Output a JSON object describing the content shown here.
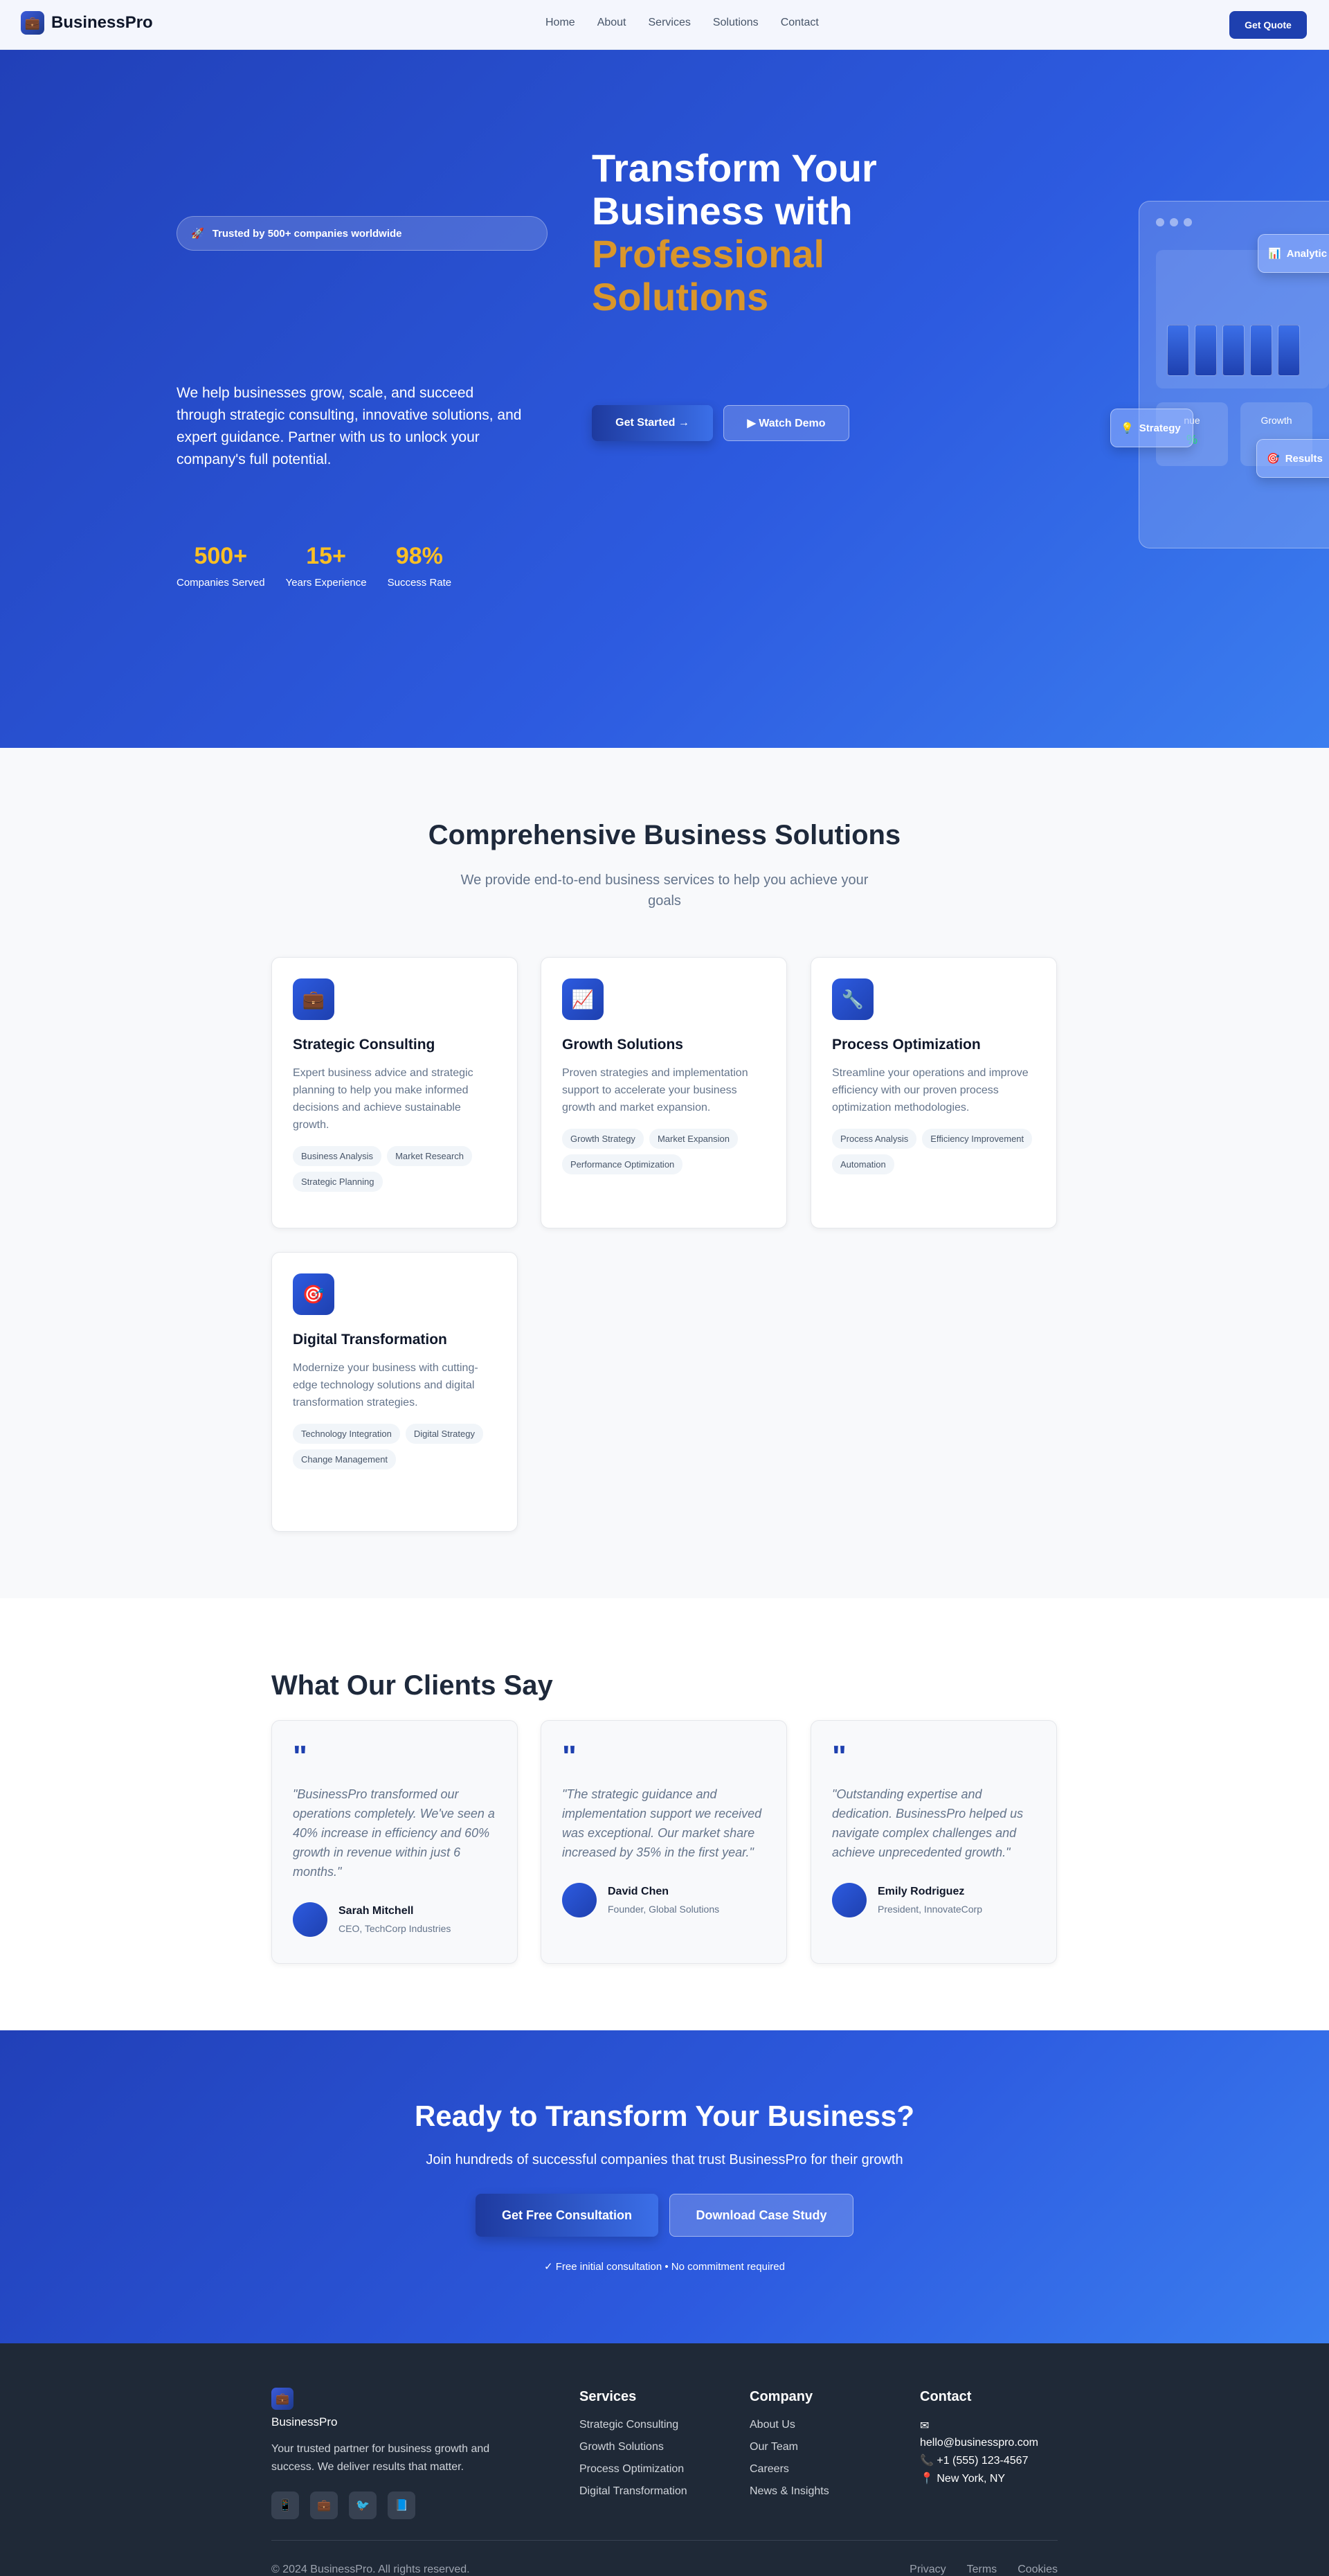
{
  "brand": {
    "name": "BusinessPro",
    "accent": "#1e40af",
    "highlight": "#d9962b"
  },
  "nav": {
    "links": [
      "Home",
      "About",
      "Services",
      "Solutions",
      "Contact"
    ],
    "cta": "Get Quote"
  },
  "hero": {
    "badge": "Trusted by 500+ companies worldwide",
    "title_line1": "Transform Your",
    "title_line2": "Business with",
    "title_highlight1": "Professional",
    "title_highlight2": "Solutions",
    "description": "We help businesses grow, scale, and succeed through strategic consulting, innovative solutions, and expert guidance. Partner with us to unlock your company's full potential.",
    "primary_button": "Get Started →",
    "secondary_button": "▶ Watch Demo",
    "stats": [
      {
        "value": "500+",
        "label": "Companies Served"
      },
      {
        "value": "15+",
        "label": "Years Experience"
      },
      {
        "value": "98%",
        "label": "Success Rate"
      }
    ],
    "dashboard": {
      "mini1_label": "nue",
      "mini1_value": "%",
      "mini2_label": "Growth",
      "mini2_value": "",
      "chips": [
        "Analytic",
        "Strategy",
        "Results"
      ]
    }
  },
  "solutions": {
    "title": "Comprehensive Business Solutions",
    "subtitle": "We provide end-to-end business services to help you achieve your goals",
    "cards": [
      {
        "title": "Strategic Consulting",
        "icon": "briefcase-icon",
        "description": "Expert business advice and strategic planning to help you make informed decisions and achieve sustainable growth.",
        "tags": [
          "Business Analysis",
          "Market Research",
          "Strategic Planning"
        ]
      },
      {
        "title": "Growth Solutions",
        "icon": "chart-icon",
        "description": "Proven strategies and implementation support to accelerate your business growth and market expansion.",
        "tags": [
          "Growth Strategy",
          "Market Expansion",
          "Performance Optimization"
        ]
      },
      {
        "title": "Process Optimization",
        "icon": "tools-icon",
        "description": "Streamline your operations and improve efficiency with our proven process optimization methodologies.",
        "tags": [
          "Process Analysis",
          "Efficiency Improvement",
          "Automation"
        ]
      },
      {
        "title": "Digital Transformation",
        "icon": "target-icon",
        "description": "Modernize your business with cutting-edge technology solutions and digital transformation strategies.",
        "tags": [
          "Technology Integration",
          "Digital Strategy",
          "Change Management"
        ]
      }
    ]
  },
  "testimonials": {
    "title": "What Our Clients Say",
    "items": [
      {
        "quote": "\"BusinessPro transformed our operations completely. We've seen a 40% increase in efficiency and 60% growth in revenue within just 6 months.\"",
        "name": "Sarah Mitchell",
        "role": "CEO, TechCorp Industries"
      },
      {
        "quote": "\"The strategic guidance and implementation support we received was exceptional. Our market share increased by 35% in the first year.\"",
        "name": "David Chen",
        "role": "Founder, Global Solutions"
      },
      {
        "quote": "\"Outstanding expertise and dedication. BusinessPro helped us navigate complex challenges and achieve unprecedented growth.\"",
        "name": "Emily Rodriguez",
        "role": "President, InnovateCorp"
      }
    ]
  },
  "cta": {
    "title": "Ready to Transform Your Business?",
    "subtitle": "Join hundreds of successful companies that trust BusinessPro for their growth",
    "primary_button": "Get Free Consultation",
    "secondary_button": "Download Case Study",
    "note": "✓ Free initial consultation • No commitment required"
  },
  "footer": {
    "brand": "BusinessPro",
    "description": "Your trusted partner for business growth and success. We deliver results that matter.",
    "services_title": "Services",
    "services": [
      "Strategic Consulting",
      "Growth Solutions",
      "Process Optimization",
      "Digital Transformation"
    ],
    "company_title": "Company",
    "company": [
      "About Us",
      "Our Team",
      "Careers",
      "News & Insights"
    ],
    "contact_title": "Contact",
    "contact": [
      "✉",
      "hello@businesspro.com",
      "📞 +1 (555) 123-4567",
      "📍 New York, NY"
    ],
    "copyright": "© 2024 BusinessPro. All rights reserved.",
    "legal": [
      "Privacy",
      "Terms",
      "Cookies"
    ]
  }
}
